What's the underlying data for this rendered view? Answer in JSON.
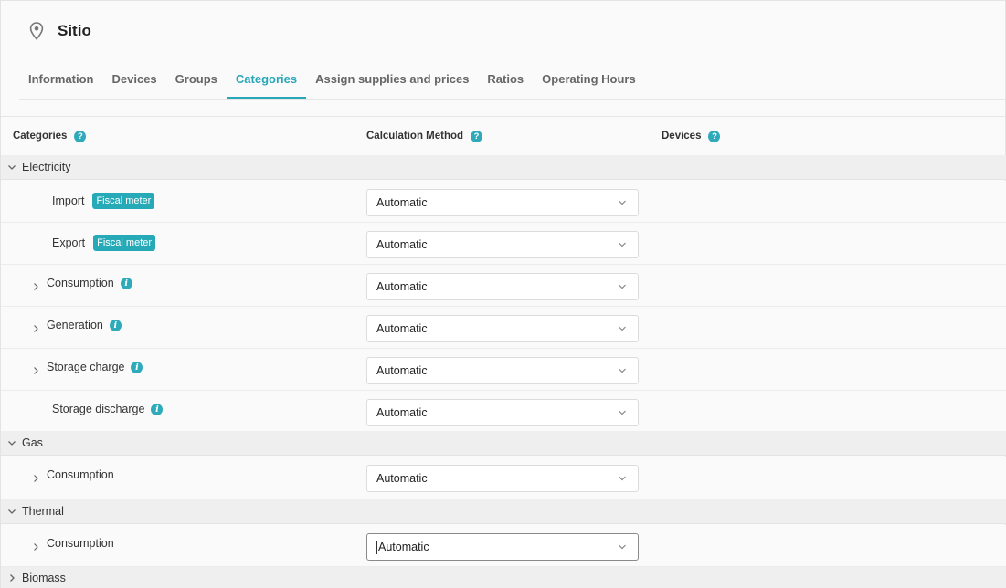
{
  "site": {
    "title": "Sitio",
    "icon": "location-pin-icon"
  },
  "tabs": [
    {
      "label": "Information"
    },
    {
      "label": "Devices"
    },
    {
      "label": "Groups"
    },
    {
      "label": "Categories",
      "active": true
    },
    {
      "label": "Assign supplies and prices"
    },
    {
      "label": "Ratios"
    },
    {
      "label": "Operating Hours"
    }
  ],
  "columns": {
    "categories": "Categories",
    "calculation_method": "Calculation Method",
    "devices": "Devices",
    "help_glyph": "?"
  },
  "info_glyph": "i",
  "accent_color": "#27a7b8",
  "groups": {
    "electricity": {
      "name": "Electricity",
      "items": [
        {
          "label": "Import",
          "badge": "Fiscal meter",
          "method": "Automatic"
        },
        {
          "label": "Export",
          "badge": "Fiscal meter",
          "method": "Automatic"
        },
        {
          "label": "Consumption",
          "method": "Automatic"
        },
        {
          "label": "Generation",
          "method": "Automatic"
        },
        {
          "label": "Storage charge",
          "method": "Automatic"
        },
        {
          "label": "Storage discharge",
          "method": "Automatic"
        }
      ]
    },
    "gas": {
      "name": "Gas",
      "items": [
        {
          "label": "Consumption",
          "method": "Automatic"
        }
      ]
    },
    "thermal": {
      "name": "Thermal",
      "items": [
        {
          "label": "Consumption",
          "method": "Automatic"
        }
      ]
    },
    "biomass": {
      "name": "Biomass"
    }
  }
}
